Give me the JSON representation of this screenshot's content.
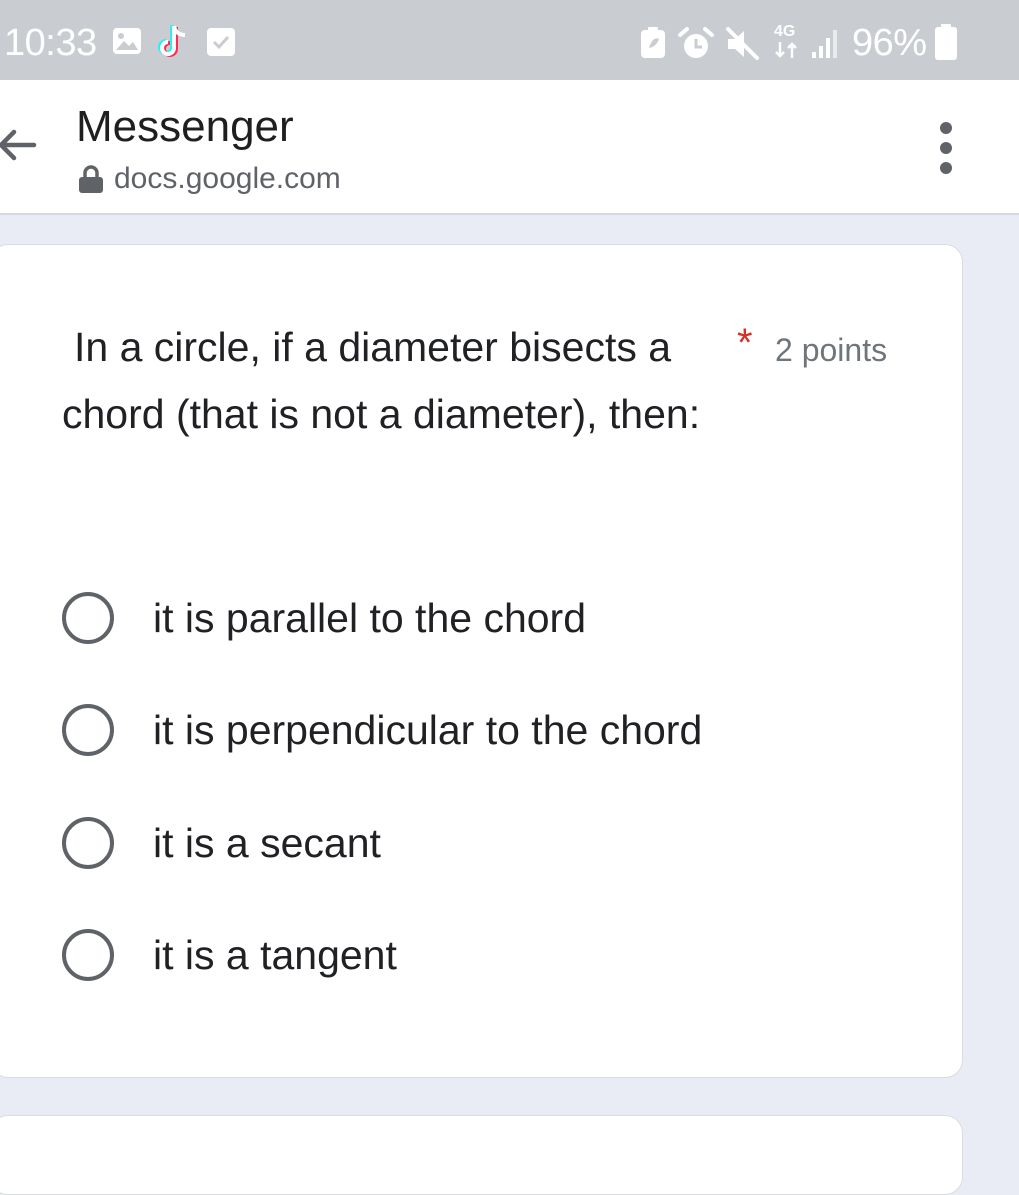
{
  "status_bar": {
    "time": "10:33",
    "network": "4G",
    "battery": "96%",
    "icons": [
      "gallery-icon",
      "tiktok-icon",
      "checkbox-icon",
      "battery-saver-icon",
      "alarm-icon",
      "mute-icon",
      "data-arrows-icon",
      "signal-icon",
      "battery-icon"
    ]
  },
  "header": {
    "title": "Messenger",
    "url": "docs.google.com",
    "icons": [
      "back-arrow-icon",
      "lock-icon",
      "more-vert-icon"
    ]
  },
  "question": {
    "text": "In a circle, if a diameter bisects a chord (that is not a diameter), then:",
    "required_marker": "*",
    "points": "2 points",
    "options": [
      "it is parallel to the chord",
      "it is perpendicular to the chord",
      "it is a secant",
      "it is a tangent"
    ],
    "selected": null
  },
  "colors": {
    "status_bar_bg": "#c9ccd0",
    "page_bg": "#e9ecf4",
    "required": "#d93025",
    "text": "#202124",
    "secondary_text": "#5f6368"
  }
}
